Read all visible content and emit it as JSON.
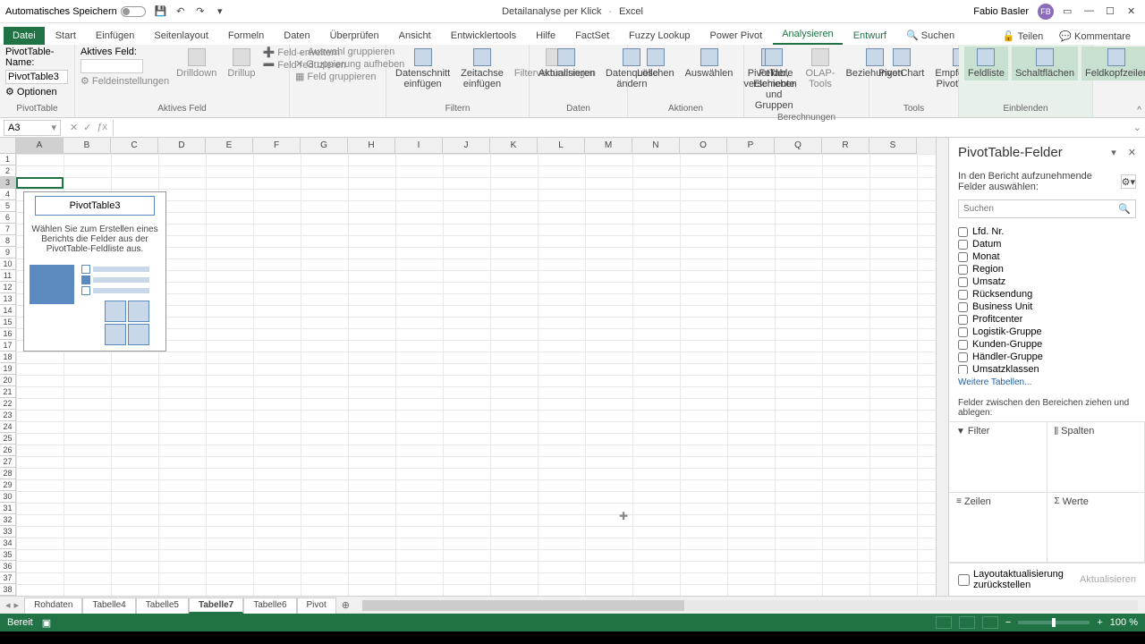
{
  "titlebar": {
    "autosave": "Automatisches Speichern",
    "doc": "Detailanalyse per Klick",
    "app": "Excel",
    "user": "Fabio Basler",
    "initials": "FB"
  },
  "tabs": {
    "file": "Datei",
    "list": [
      "Start",
      "Einfügen",
      "Seitenlayout",
      "Formeln",
      "Daten",
      "Überprüfen",
      "Ansicht",
      "Entwicklertools",
      "Hilfe",
      "FactSet",
      "Fuzzy Lookup",
      "Power Pivot"
    ],
    "context": [
      "Analysieren",
      "Entwurf"
    ],
    "search": "Suchen",
    "share": "Teilen",
    "comments": "Kommentare"
  },
  "ribbon": {
    "pt_name_label": "PivotTable-Name:",
    "pt_name": "PivotTable3",
    "options": "Optionen",
    "g_pivot": "PivotTable",
    "active_field": "Aktives Feld:",
    "drilldown": "Drilldown",
    "drillup": "Drillup",
    "field_settings": "Feldeinstellungen",
    "expand": "Feld erweitern",
    "collapse": "Feld reduzieren",
    "g_active": "Aktives Feld",
    "grp_sel": "Auswahl gruppieren",
    "grp_cancel": "Gruppierung aufheben",
    "grp_field": "Feld gruppieren",
    "slicer": "Datenschnitt einfügen",
    "timeline": "Zeitachse einfügen",
    "filter_conn": "Filterverbindungen",
    "g_filter": "Filtern",
    "refresh": "Aktualisieren",
    "change_src": "Datenquelle ändern",
    "g_data": "Daten",
    "clear": "Löschen",
    "select": "Auswählen",
    "move": "PivotTable verschieben",
    "g_actions": "Aktionen",
    "fields_items": "Felder, Elemente und Gruppen",
    "olap": "OLAP-Tools",
    "relations": "Beziehungen",
    "g_calc": "Berechnungen",
    "pivotchart": "PivotChart",
    "recommended": "Empfohlene PivotTables",
    "g_tools": "Tools",
    "fieldlist": "Feldliste",
    "buttons": "Schaltflächen",
    "headers": "Feldkopfzeilen",
    "g_show": "Einblenden"
  },
  "formula": {
    "namebox": "A3"
  },
  "columns": [
    "A",
    "B",
    "C",
    "D",
    "E",
    "F",
    "G",
    "H",
    "I",
    "J",
    "K",
    "L",
    "M",
    "N",
    "O",
    "P",
    "Q",
    "R",
    "S"
  ],
  "pivot_placeholder": {
    "title": "PivotTable3",
    "text": "Wählen Sie zum Erstellen eines Berichts die Felder aus der PivotTable-Feldliste aus."
  },
  "pane": {
    "title": "PivotTable-Felder",
    "subtitle": "In den Bericht aufzunehmende Felder auswählen:",
    "search_ph": "Suchen",
    "fields": [
      "Lfd. Nr.",
      "Datum",
      "Monat",
      "Region",
      "Umsatz",
      "Rücksendung",
      "Business Unit",
      "Profitcenter",
      "Logistik-Gruppe",
      "Kunden-Gruppe",
      "Händler-Gruppe",
      "Umsatzklassen"
    ],
    "more": "Weitere Tabellen...",
    "drag_label": "Felder zwischen den Bereichen ziehen und ablegen:",
    "area_filter": "Filter",
    "area_cols": "Spalten",
    "area_rows": "Zeilen",
    "area_vals": "Werte",
    "defer": "Layoutaktualisierung zurückstellen",
    "update": "Aktualisieren"
  },
  "sheets": {
    "list": [
      "Rohdaten",
      "Tabelle4",
      "Tabelle5",
      "Tabelle7",
      "Tabelle6",
      "Pivot"
    ],
    "active": "Tabelle7"
  },
  "status": {
    "ready": "Bereit",
    "zoom": "100 %"
  }
}
